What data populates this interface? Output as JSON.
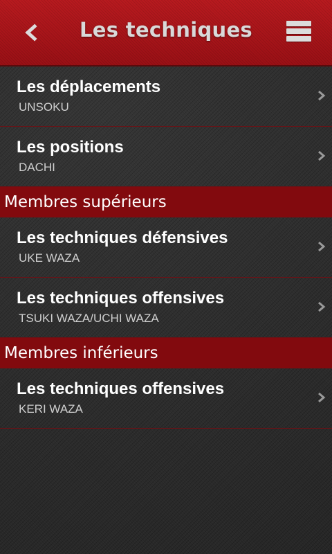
{
  "header": {
    "title": "Les techniques",
    "back_icon": "chevron-left-icon",
    "menu_icon": "list-menu-icon"
  },
  "items_top": [
    {
      "title": "Les déplacements",
      "subtitle": "UNSOKU"
    },
    {
      "title": "Les positions",
      "subtitle": "DACHI"
    }
  ],
  "sections": [
    {
      "label": "Membres supérieurs",
      "items": [
        {
          "title": "Les techniques défensives",
          "subtitle": "UKE WAZA"
        },
        {
          "title": "Les techniques offensives",
          "subtitle": "TSUKI WAZA/UCHI WAZA"
        }
      ]
    },
    {
      "label": "Membres inférieurs",
      "items": [
        {
          "title": "Les techniques offensives",
          "subtitle": "KERI WAZA"
        }
      ]
    }
  ],
  "colors": {
    "header": "#a8141a",
    "section": "#820a0e",
    "background": "#2b2b2b",
    "divider": "#6e1014"
  }
}
